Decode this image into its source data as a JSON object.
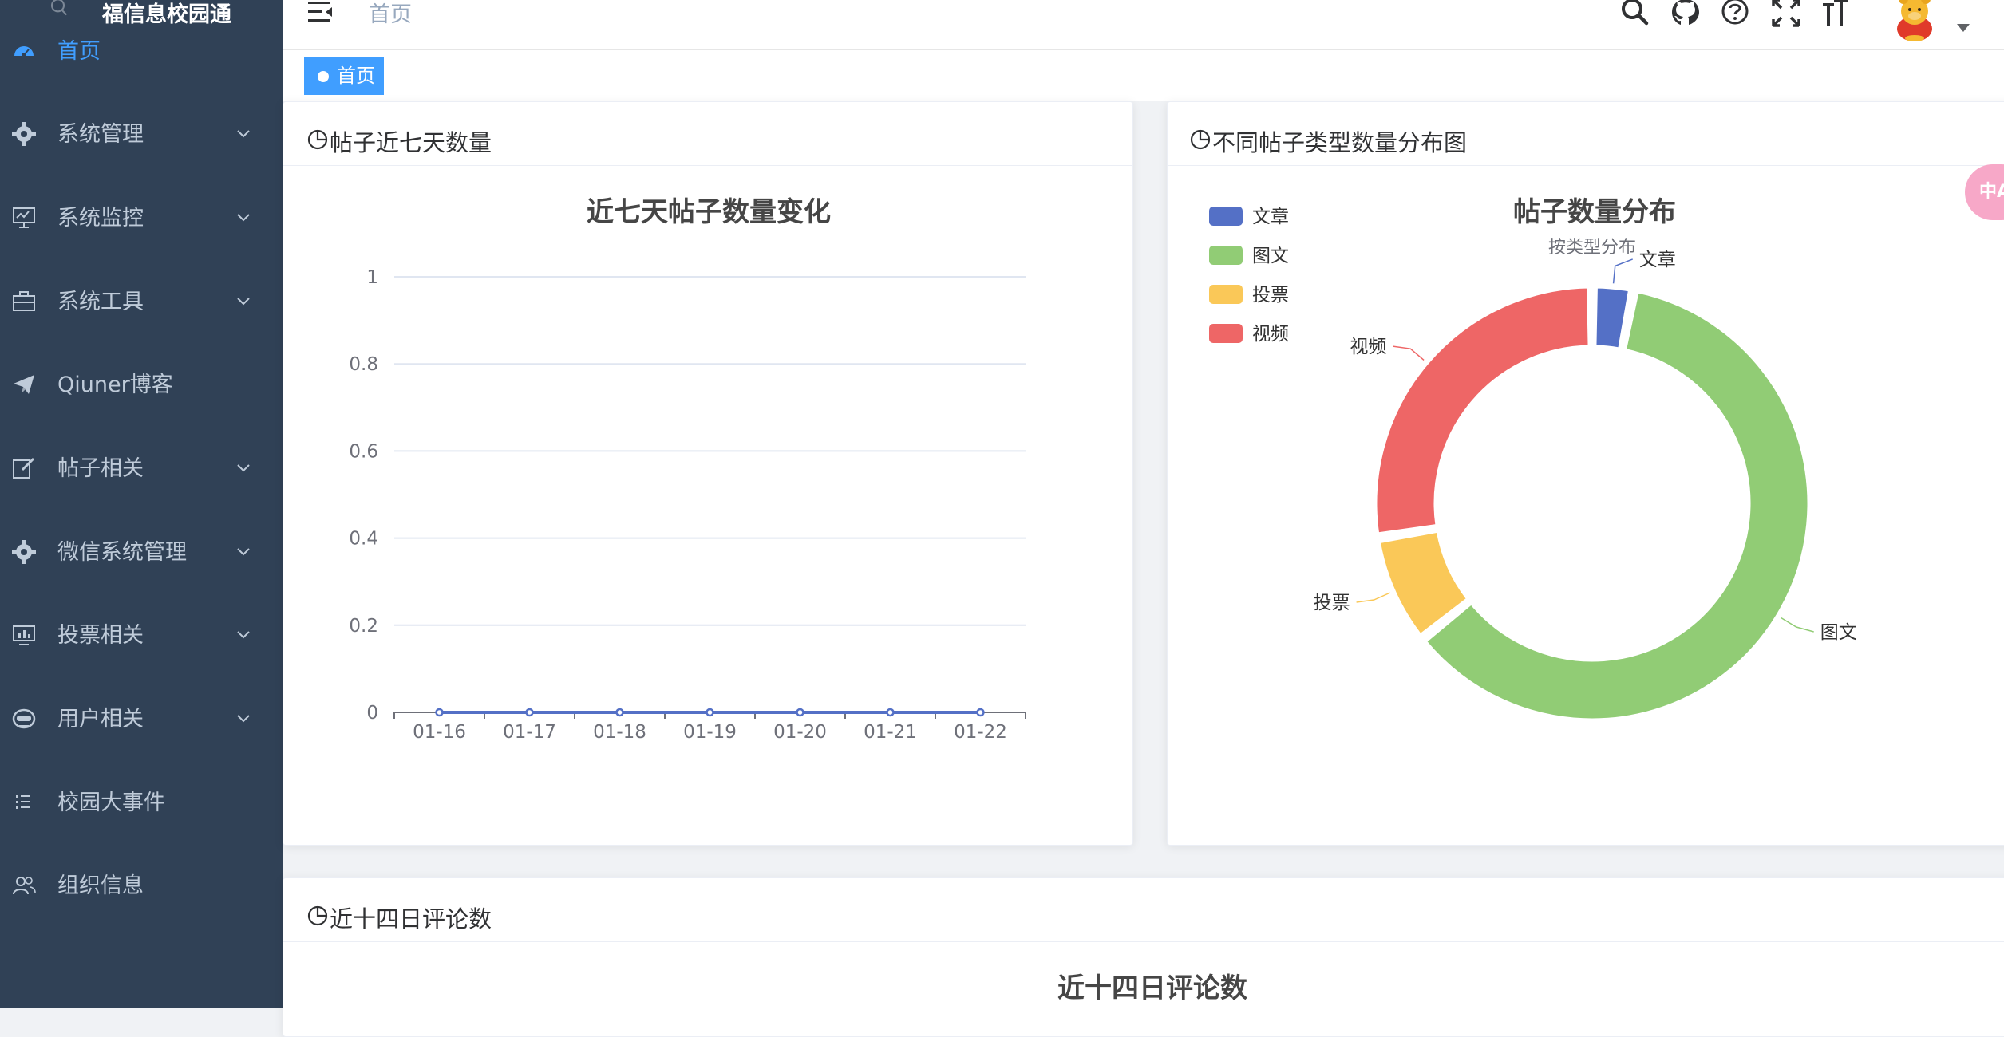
{
  "app": {
    "title": "福信息校园通"
  },
  "sidebar": {
    "items": [
      {
        "label": "首页",
        "icon": "dashboard-icon",
        "has_children": false,
        "active": true
      },
      {
        "label": "系统管理",
        "icon": "gear-icon",
        "has_children": true
      },
      {
        "label": "系统监控",
        "icon": "monitor-icon",
        "has_children": true
      },
      {
        "label": "系统工具",
        "icon": "toolbox-icon",
        "has_children": true
      },
      {
        "label": "Qiuner博客",
        "icon": "paper-plane-icon",
        "has_children": false
      },
      {
        "label": "帖子相关",
        "icon": "edit-icon",
        "has_children": true
      },
      {
        "label": "微信系统管理",
        "icon": "gear-icon",
        "has_children": true
      },
      {
        "label": "投票相关",
        "icon": "chart-board-icon",
        "has_children": true
      },
      {
        "label": "用户相关",
        "icon": "user-face-icon",
        "has_children": true
      },
      {
        "label": "校园大事件",
        "icon": "list-icon",
        "has_children": false
      },
      {
        "label": "组织信息",
        "icon": "people-icon",
        "has_children": false
      }
    ]
  },
  "header": {
    "breadcrumb": "首页",
    "icons": [
      "search-icon",
      "github-icon",
      "question-icon",
      "fullscreen-icon",
      "font-size-icon"
    ]
  },
  "tags": {
    "active": "首页"
  },
  "cards": {
    "posts7": {
      "title": "帖子近七天数量"
    },
    "types": {
      "title": "不同帖子类型数量分布图"
    },
    "comments14": {
      "title": "近十四日评论数"
    }
  },
  "chart_data": [
    {
      "type": "line",
      "title": "近七天帖子数量变化",
      "x": [
        "01-16",
        "01-17",
        "01-18",
        "01-19",
        "01-20",
        "01-21",
        "01-22"
      ],
      "series": [
        {
          "values": [
            0,
            0,
            0,
            0,
            0,
            0,
            0
          ],
          "color": "#5470c6"
        }
      ],
      "ylim": [
        0,
        1
      ],
      "yticks": [
        "1",
        "0.8",
        "0.6",
        "0.4",
        "0.2",
        "0"
      ],
      "grid": true
    },
    {
      "type": "pie",
      "title": "帖子数量分布",
      "subtitle": "按类型分布",
      "legend_position": "top-left",
      "slices": [
        {
          "name": "文章",
          "value": 3,
          "color": "#5470c6"
        },
        {
          "name": "图文",
          "value": 60,
          "color": "#91cc75"
        },
        {
          "name": "投票",
          "value": 8,
          "color": "#fac858"
        },
        {
          "name": "视频",
          "value": 27,
          "color": "#ee6666"
        }
      ]
    },
    {
      "type": "bar",
      "title": "近十四日评论数"
    }
  ],
  "floating": {
    "label": "中A"
  }
}
